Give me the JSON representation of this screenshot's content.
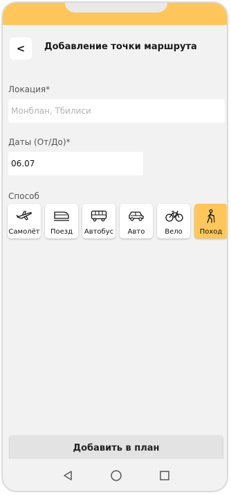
{
  "header": {
    "back_label": "<",
    "title": "Добавление точки маршрута"
  },
  "location": {
    "label": "Локация*",
    "placeholder": "Монблан, Тбилиси",
    "value": ""
  },
  "dates": {
    "label": "Даты (От/До)*",
    "value": "06.07"
  },
  "transport": {
    "label": "Способ",
    "selected": "Поход",
    "modes": [
      {
        "label": "Самолёт",
        "icon": "airplane-icon"
      },
      {
        "label": "Поезд",
        "icon": "train-icon"
      },
      {
        "label": "Автобус",
        "icon": "bus-icon"
      },
      {
        "label": "Авто",
        "icon": "car-icon"
      },
      {
        "label": "Вело",
        "icon": "bicycle-icon"
      },
      {
        "label": "Поход",
        "icon": "hiking-icon"
      }
    ]
  },
  "actions": {
    "add_label": "Добавить в план"
  },
  "colors": {
    "accent": "#ffc65c",
    "background": "#f2f2f2"
  },
  "nav": {
    "icons": [
      "back-triangle-icon",
      "home-circle-icon",
      "recents-square-icon"
    ]
  }
}
